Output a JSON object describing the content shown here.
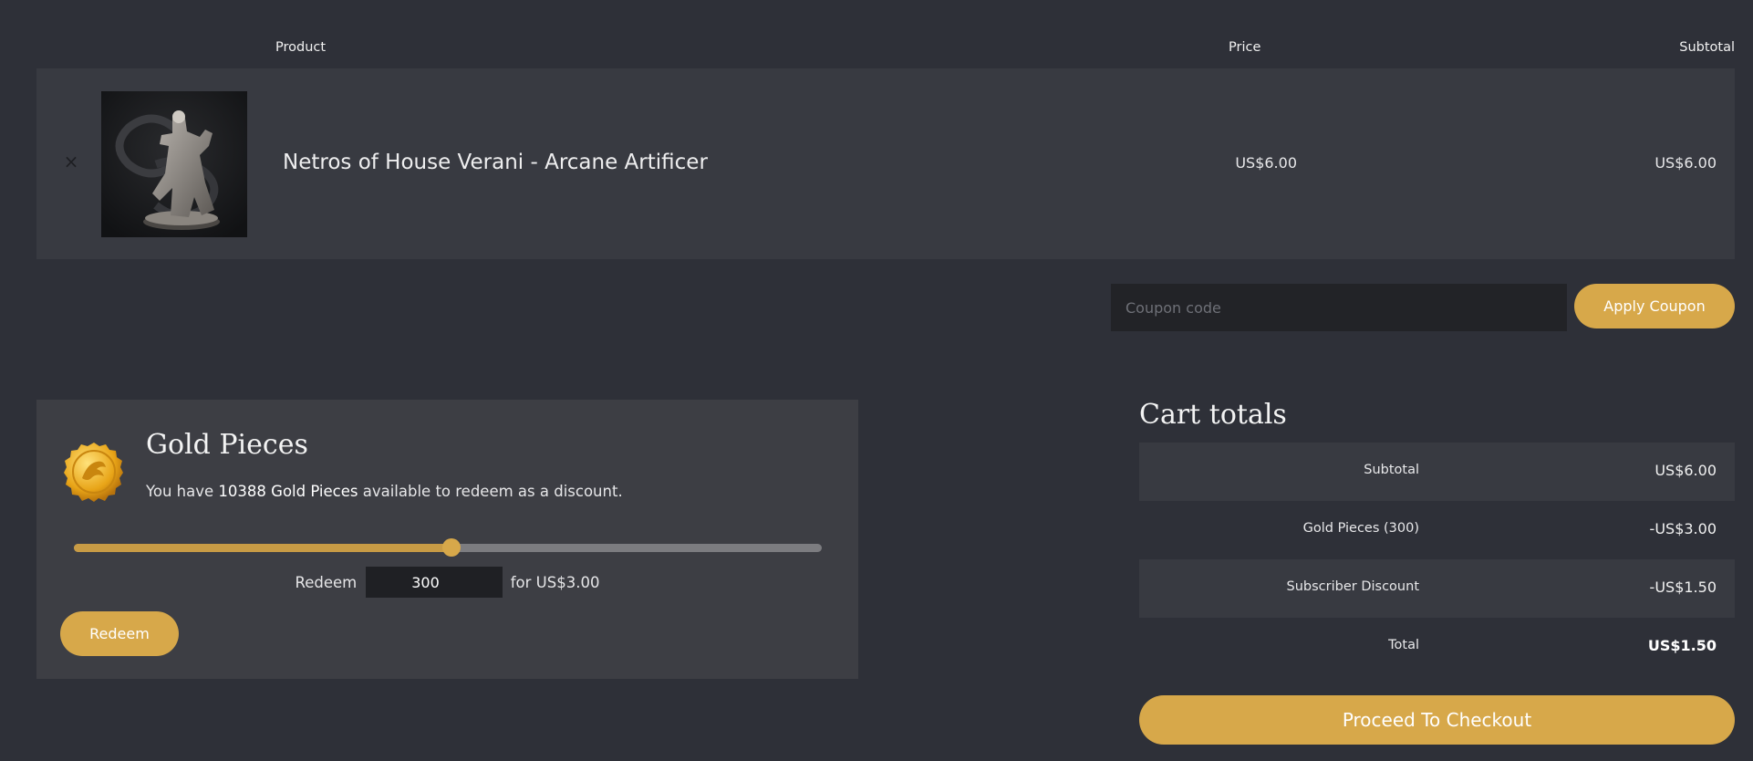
{
  "cart": {
    "headers": {
      "product": "Product",
      "price": "Price",
      "subtotal": "Subtotal"
    },
    "items": [
      {
        "remove_icon": "×",
        "name": "Netros of House Verani - Arcane Artificer",
        "price": "US$6.00",
        "subtotal": "US$6.00"
      }
    ]
  },
  "coupon": {
    "placeholder": "Coupon code",
    "apply_label": "Apply Coupon"
  },
  "gold": {
    "title": "Gold Pieces",
    "desc_prefix": "You have ",
    "balance_text": "10388 Gold Pieces",
    "desc_suffix": " available to redeem as a discount.",
    "slider_fraction": 0.505,
    "redeem_prefix": "Redeem",
    "redeem_amount": "300",
    "redeem_suffix": "for US$3.00",
    "redeem_button": "Redeem",
    "icon": "gold-coin-icon"
  },
  "totals": {
    "title": "Cart totals",
    "rows": [
      {
        "label": "Subtotal",
        "value": "US$6.00"
      },
      {
        "label": "Gold Pieces (300)",
        "value": "-US$3.00"
      },
      {
        "label": "Subscriber Discount",
        "value": "-US$1.50"
      },
      {
        "label": "Total",
        "value": "US$1.50"
      }
    ],
    "checkout_label": "Proceed To Checkout"
  },
  "colors": {
    "background": "#2e3038",
    "row": "#383a41",
    "accent": "#d7a84a"
  }
}
